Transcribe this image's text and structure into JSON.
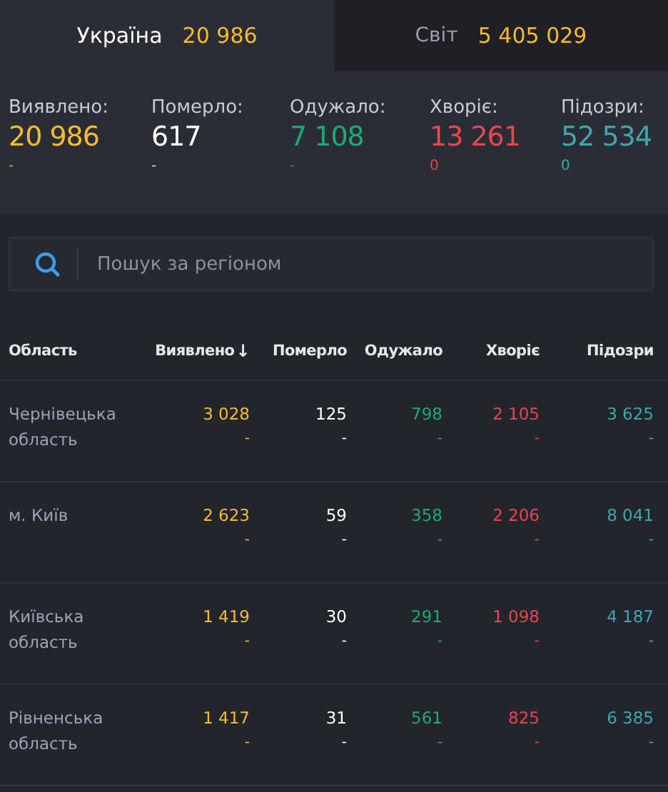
{
  "tabs": [
    {
      "label": "Україна",
      "count": "20 986",
      "selected": true
    },
    {
      "label": "Світ",
      "count": "5 405 029",
      "selected": false
    }
  ],
  "stats": [
    {
      "label": "Виявлено:",
      "value": "20 986",
      "delta": "-",
      "color": "#f9bb2d"
    },
    {
      "label": "Померло:",
      "value": "617",
      "delta": "-",
      "color": "#ffffff"
    },
    {
      "label": "Одужало:",
      "value": "7 108",
      "delta": "-",
      "color": "#1fa971"
    },
    {
      "label": "Хворіє:",
      "value": "13 261",
      "delta": "0",
      "color": "#e8474c"
    },
    {
      "label": "Підозри:",
      "value": "52 534",
      "delta": "0",
      "color": "#3fa6b0"
    }
  ],
  "search": {
    "placeholder": "Пошук за регіоном"
  },
  "table": {
    "columns": [
      {
        "label": "Область"
      },
      {
        "label": "Виявлено",
        "sort_icon": "↓",
        "color": "#f9bb2d"
      },
      {
        "label": "Померло",
        "color": "#ffffff"
      },
      {
        "label": "Одужало",
        "color": "#1fa971"
      },
      {
        "label": "Хворіє",
        "color": "#e8474c"
      },
      {
        "label": "Підозри",
        "color": "#3fa6b0"
      }
    ],
    "rows": [
      {
        "cells": [
          {
            "value": "Чернівецька область"
          },
          {
            "value": "3 028",
            "delta": "-"
          },
          {
            "value": "125",
            "delta": "-"
          },
          {
            "value": "798",
            "delta": "-"
          },
          {
            "value": "2 105",
            "delta": "-"
          },
          {
            "value": "3 625",
            "delta": "-"
          }
        ]
      },
      {
        "cells": [
          {
            "value": "м. Київ"
          },
          {
            "value": "2 623",
            "delta": "-"
          },
          {
            "value": "59",
            "delta": "-"
          },
          {
            "value": "358",
            "delta": "-"
          },
          {
            "value": "2 206",
            "delta": "-"
          },
          {
            "value": "8 041",
            "delta": "-"
          }
        ]
      },
      {
        "cells": [
          {
            "value": "Київська область"
          },
          {
            "value": "1 419",
            "delta": "-"
          },
          {
            "value": "30",
            "delta": "-"
          },
          {
            "value": "291",
            "delta": "-"
          },
          {
            "value": "1 098",
            "delta": "-"
          },
          {
            "value": "4 187",
            "delta": "-"
          }
        ]
      },
      {
        "cells": [
          {
            "value": "Рівненська область"
          },
          {
            "value": "1 417",
            "delta": "-"
          },
          {
            "value": "31",
            "delta": "-"
          },
          {
            "value": "561",
            "delta": "-"
          },
          {
            "value": "825",
            "delta": "-"
          },
          {
            "value": "6 385",
            "delta": "-"
          }
        ]
      }
    ]
  }
}
